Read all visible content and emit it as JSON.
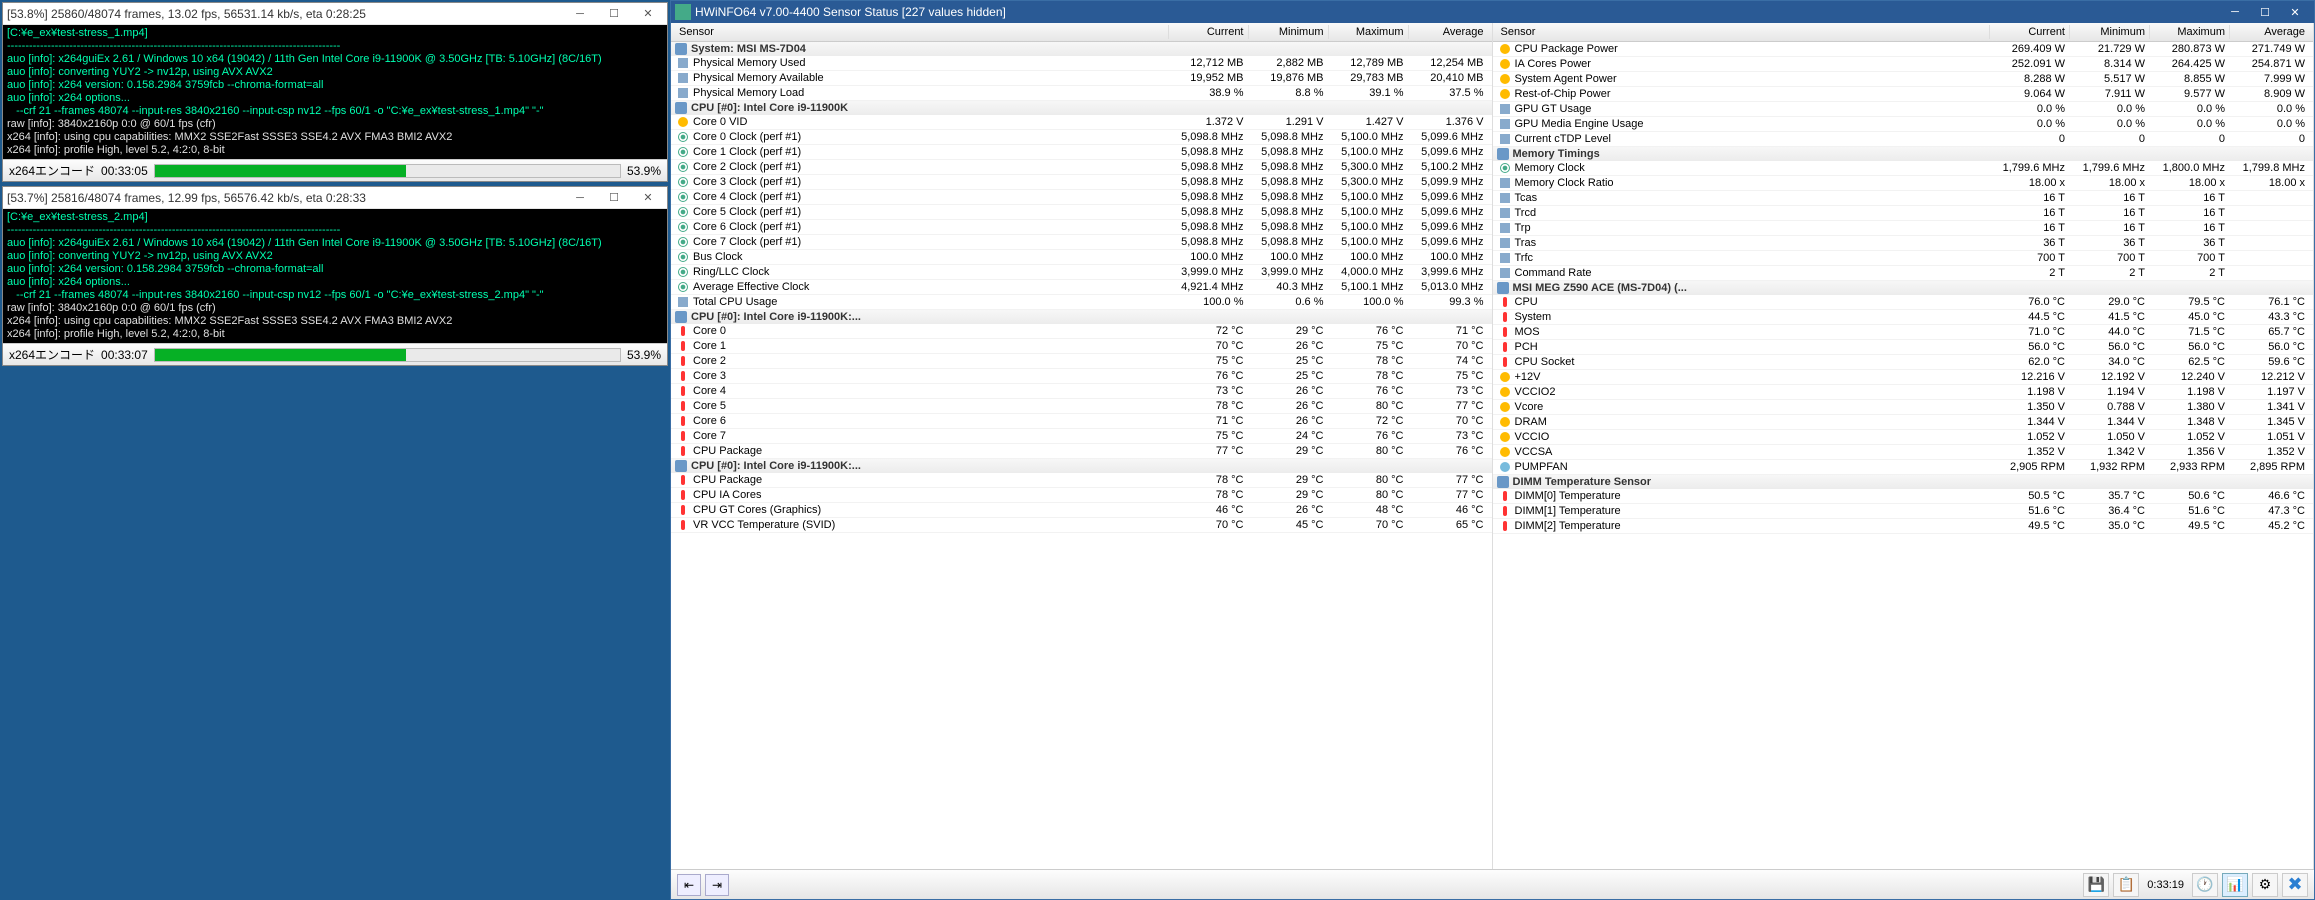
{
  "console1": {
    "title": "[53.8%] 25860/48074 frames, 13.02 fps, 56531.14 kb/s, eta 0:28:25",
    "lines": [
      {
        "cls": "cyan",
        "t": "[C:¥e_ex¥test-stress_1.mp4]"
      },
      {
        "cls": "cyan",
        "t": "-------------------------------------------------------------------------------------------"
      },
      {
        "cls": "cyan",
        "t": "auo [info]: x264guiEx 2.61 / Windows 10 x64 (19042) / 11th Gen Intel Core i9-11900K @ 3.50GHz [TB: 5.10GHz] (8C/16T)"
      },
      {
        "cls": "cyan",
        "t": "auo [info]: converting YUY2 -> nv12p, using AVX AVX2"
      },
      {
        "cls": "cyan",
        "t": "auo [info]: x264 version: 0.158.2984 3759fcb --chroma-format=all"
      },
      {
        "cls": "cyan",
        "t": "auo [info]: x264 options..."
      },
      {
        "cls": "cyan",
        "t": "   --crf 21 --frames 48074 --input-res 3840x2160 --input-csp nv12 --fps 60/1 -o \"C:¥e_ex¥test-stress_1.mp4\" \"-\""
      },
      {
        "cls": "white",
        "t": "raw [info]: 3840x2160p 0:0 @ 60/1 fps (cfr)"
      },
      {
        "cls": "white",
        "t": "x264 [info]: using cpu capabilities: MMX2 SSE2Fast SSSE3 SSE4.2 AVX FMA3 BMI2 AVX2"
      },
      {
        "cls": "white",
        "t": "x264 [info]: profile High, level 5.2, 4:2:0, 8-bit"
      }
    ],
    "status_label": "x264エンコード",
    "status_time": "00:33:05",
    "progress_pct": 53.9,
    "progress_text": "53.9%"
  },
  "console2": {
    "title": "[53.7%] 25816/48074 frames, 12.99 fps, 56576.42 kb/s, eta 0:28:33",
    "lines": [
      {
        "cls": "cyan",
        "t": "[C:¥e_ex¥test-stress_2.mp4]"
      },
      {
        "cls": "cyan",
        "t": "-------------------------------------------------------------------------------------------"
      },
      {
        "cls": "cyan",
        "t": "auo [info]: x264guiEx 2.61 / Windows 10 x64 (19042) / 11th Gen Intel Core i9-11900K @ 3.50GHz [TB: 5.10GHz] (8C/16T)"
      },
      {
        "cls": "cyan",
        "t": "auo [info]: converting YUY2 -> nv12p, using AVX AVX2"
      },
      {
        "cls": "cyan",
        "t": "auo [info]: x264 version: 0.158.2984 3759fcb --chroma-format=all"
      },
      {
        "cls": "cyan",
        "t": "auo [info]: x264 options..."
      },
      {
        "cls": "cyan",
        "t": "   --crf 21 --frames 48074 --input-res 3840x2160 --input-csp nv12 --fps 60/1 -o \"C:¥e_ex¥test-stress_2.mp4\" \"-\""
      },
      {
        "cls": "white",
        "t": "raw [info]: 3840x2160p 0:0 @ 60/1 fps (cfr)"
      },
      {
        "cls": "white",
        "t": "x264 [info]: using cpu capabilities: MMX2 SSE2Fast SSSE3 SSE4.2 AVX FMA3 BMI2 AVX2"
      },
      {
        "cls": "white",
        "t": "x264 [info]: profile High, level 5.2, 4:2:0, 8-bit"
      }
    ],
    "status_label": "x264エンコード",
    "status_time": "00:33:07",
    "progress_pct": 53.9,
    "progress_text": "53.9%"
  },
  "hw": {
    "title": "HWiNFO64 v7.00-4400 Sensor Status [227 values hidden]",
    "headers": [
      "Sensor",
      "Current",
      "Minimum",
      "Maximum",
      "Average"
    ],
    "left_groups": [
      {
        "name": "System: MSI MS-7D04",
        "rows": [
          {
            "ic": "mem",
            "n": "Physical Memory Used",
            "v": [
              "12,712 MB",
              "2,882 MB",
              "12,789 MB",
              "12,254 MB"
            ]
          },
          {
            "ic": "mem",
            "n": "Physical Memory Available",
            "v": [
              "19,952 MB",
              "19,876 MB",
              "29,783 MB",
              "20,410 MB"
            ]
          },
          {
            "ic": "mem",
            "n": "Physical Memory Load",
            "v": [
              "38.9 %",
              "8.8 %",
              "39.1 %",
              "37.5 %"
            ]
          }
        ]
      },
      {
        "name": "CPU [#0]: Intel Core i9-11900K",
        "rows": [
          {
            "ic": "volt",
            "n": "Core 0 VID",
            "v": [
              "1.372 V",
              "1.291 V",
              "1.427 V",
              "1.376 V"
            ]
          },
          {
            "ic": "clock",
            "n": "Core 0 Clock (perf #1)",
            "v": [
              "5,098.8 MHz",
              "5,098.8 MHz",
              "5,100.0 MHz",
              "5,099.6 MHz"
            ]
          },
          {
            "ic": "clock",
            "n": "Core 1 Clock (perf #1)",
            "v": [
              "5,098.8 MHz",
              "5,098.8 MHz",
              "5,100.0 MHz",
              "5,099.6 MHz"
            ]
          },
          {
            "ic": "clock",
            "n": "Core 2 Clock (perf #1)",
            "v": [
              "5,098.8 MHz",
              "5,098.8 MHz",
              "5,300.0 MHz",
              "5,100.2 MHz"
            ]
          },
          {
            "ic": "clock",
            "n": "Core 3 Clock (perf #1)",
            "v": [
              "5,098.8 MHz",
              "5,098.8 MHz",
              "5,300.0 MHz",
              "5,099.9 MHz"
            ]
          },
          {
            "ic": "clock",
            "n": "Core 4 Clock (perf #1)",
            "v": [
              "5,098.8 MHz",
              "5,098.8 MHz",
              "5,100.0 MHz",
              "5,099.6 MHz"
            ]
          },
          {
            "ic": "clock",
            "n": "Core 5 Clock (perf #1)",
            "v": [
              "5,098.8 MHz",
              "5,098.8 MHz",
              "5,100.0 MHz",
              "5,099.6 MHz"
            ]
          },
          {
            "ic": "clock",
            "n": "Core 6 Clock (perf #1)",
            "v": [
              "5,098.8 MHz",
              "5,098.8 MHz",
              "5,100.0 MHz",
              "5,099.6 MHz"
            ]
          },
          {
            "ic": "clock",
            "n": "Core 7 Clock (perf #1)",
            "v": [
              "5,098.8 MHz",
              "5,098.8 MHz",
              "5,100.0 MHz",
              "5,099.6 MHz"
            ]
          },
          {
            "ic": "clock",
            "n": "Bus Clock",
            "v": [
              "100.0 MHz",
              "100.0 MHz",
              "100.0 MHz",
              "100.0 MHz"
            ]
          },
          {
            "ic": "clock",
            "n": "Ring/LLC Clock",
            "v": [
              "3,999.0 MHz",
              "3,999.0 MHz",
              "4,000.0 MHz",
              "3,999.6 MHz"
            ]
          },
          {
            "ic": "clock",
            "n": "Average Effective Clock",
            "v": [
              "4,921.4 MHz",
              "40.3 MHz",
              "5,100.1 MHz",
              "5,013.0 MHz"
            ]
          },
          {
            "ic": "mem",
            "n": "Total CPU Usage",
            "v": [
              "100.0 %",
              "0.6 %",
              "100.0 %",
              "99.3 %"
            ]
          }
        ]
      },
      {
        "name": "CPU [#0]: Intel Core i9-11900K:...",
        "rows": [
          {
            "ic": "temp",
            "n": "Core 0",
            "v": [
              "72 °C",
              "29 °C",
              "76 °C",
              "71 °C"
            ]
          },
          {
            "ic": "temp",
            "n": "Core 1",
            "v": [
              "70 °C",
              "26 °C",
              "75 °C",
              "70 °C"
            ]
          },
          {
            "ic": "temp",
            "n": "Core 2",
            "v": [
              "75 °C",
              "25 °C",
              "78 °C",
              "74 °C"
            ]
          },
          {
            "ic": "temp",
            "n": "Core 3",
            "v": [
              "76 °C",
              "25 °C",
              "78 °C",
              "75 °C"
            ]
          },
          {
            "ic": "temp",
            "n": "Core 4",
            "v": [
              "73 °C",
              "26 °C",
              "76 °C",
              "73 °C"
            ]
          },
          {
            "ic": "temp",
            "n": "Core 5",
            "v": [
              "78 °C",
              "26 °C",
              "80 °C",
              "77 °C"
            ]
          },
          {
            "ic": "temp",
            "n": "Core 6",
            "v": [
              "71 °C",
              "26 °C",
              "72 °C",
              "70 °C"
            ]
          },
          {
            "ic": "temp",
            "n": "Core 7",
            "v": [
              "75 °C",
              "24 °C",
              "76 °C",
              "73 °C"
            ]
          },
          {
            "ic": "temp",
            "n": "CPU Package",
            "v": [
              "77 °C",
              "29 °C",
              "80 °C",
              "76 °C"
            ]
          }
        ]
      },
      {
        "name": "CPU [#0]: Intel Core i9-11900K:...",
        "rows": [
          {
            "ic": "temp",
            "n": "CPU Package",
            "v": [
              "78 °C",
              "29 °C",
              "80 °C",
              "77 °C"
            ]
          },
          {
            "ic": "temp",
            "n": "CPU IA Cores",
            "v": [
              "78 °C",
              "29 °C",
              "80 °C",
              "77 °C"
            ]
          },
          {
            "ic": "temp",
            "n": "CPU GT Cores (Graphics)",
            "v": [
              "46 °C",
              "26 °C",
              "48 °C",
              "46 °C"
            ]
          },
          {
            "ic": "temp",
            "n": "VR VCC Temperature (SVID)",
            "v": [
              "70 °C",
              "45 °C",
              "70 °C",
              "65 °C"
            ]
          }
        ]
      }
    ],
    "right_groups": [
      {
        "name": "",
        "rows": [
          {
            "ic": "volt",
            "n": "CPU Package Power",
            "v": [
              "269.409 W",
              "21.729 W",
              "280.873 W",
              "271.749 W"
            ]
          },
          {
            "ic": "volt",
            "n": "IA Cores Power",
            "v": [
              "252.091 W",
              "8.314 W",
              "264.425 W",
              "254.871 W"
            ]
          },
          {
            "ic": "volt",
            "n": "System Agent Power",
            "v": [
              "8.288 W",
              "5.517 W",
              "8.855 W",
              "7.999 W"
            ]
          },
          {
            "ic": "volt",
            "n": "Rest-of-Chip Power",
            "v": [
              "9.064 W",
              "7.911 W",
              "9.577 W",
              "8.909 W"
            ]
          },
          {
            "ic": "mem",
            "n": "GPU GT Usage",
            "v": [
              "0.0 %",
              "0.0 %",
              "0.0 %",
              "0.0 %"
            ]
          },
          {
            "ic": "mem",
            "n": "GPU Media Engine Usage",
            "v": [
              "0.0 %",
              "0.0 %",
              "0.0 %",
              "0.0 %"
            ]
          },
          {
            "ic": "mem",
            "n": "Current cTDP Level",
            "v": [
              "0",
              "0",
              "0",
              "0"
            ]
          }
        ]
      },
      {
        "name": "Memory Timings",
        "rows": [
          {
            "ic": "clock",
            "n": "Memory Clock",
            "v": [
              "1,799.6 MHz",
              "1,799.6 MHz",
              "1,800.0 MHz",
              "1,799.8 MHz"
            ]
          },
          {
            "ic": "mem",
            "n": "Memory Clock Ratio",
            "v": [
              "18.00 x",
              "18.00 x",
              "18.00 x",
              "18.00 x"
            ]
          },
          {
            "ic": "mem",
            "n": "Tcas",
            "v": [
              "16 T",
              "16 T",
              "16 T",
              ""
            ]
          },
          {
            "ic": "mem",
            "n": "Trcd",
            "v": [
              "16 T",
              "16 T",
              "16 T",
              ""
            ]
          },
          {
            "ic": "mem",
            "n": "Trp",
            "v": [
              "16 T",
              "16 T",
              "16 T",
              ""
            ]
          },
          {
            "ic": "mem",
            "n": "Tras",
            "v": [
              "36 T",
              "36 T",
              "36 T",
              ""
            ]
          },
          {
            "ic": "mem",
            "n": "Trfc",
            "v": [
              "700 T",
              "700 T",
              "700 T",
              ""
            ]
          },
          {
            "ic": "mem",
            "n": "Command Rate",
            "v": [
              "2 T",
              "2 T",
              "2 T",
              ""
            ]
          }
        ]
      },
      {
        "name": "MSI MEG Z590 ACE (MS-7D04) (...",
        "rows": [
          {
            "ic": "temp",
            "n": "CPU",
            "v": [
              "76.0 °C",
              "29.0 °C",
              "79.5 °C",
              "76.1 °C"
            ]
          },
          {
            "ic": "temp",
            "n": "System",
            "v": [
              "44.5 °C",
              "41.5 °C",
              "45.0 °C",
              "43.3 °C"
            ]
          },
          {
            "ic": "temp",
            "n": "MOS",
            "v": [
              "71.0 °C",
              "44.0 °C",
              "71.5 °C",
              "65.7 °C"
            ]
          },
          {
            "ic": "temp",
            "n": "PCH",
            "v": [
              "56.0 °C",
              "56.0 °C",
              "56.0 °C",
              "56.0 °C"
            ]
          },
          {
            "ic": "temp",
            "n": "CPU Socket",
            "v": [
              "62.0 °C",
              "34.0 °C",
              "62.5 °C",
              "59.6 °C"
            ]
          },
          {
            "ic": "volt",
            "n": "+12V",
            "v": [
              "12.216 V",
              "12.192 V",
              "12.240 V",
              "12.212 V"
            ]
          },
          {
            "ic": "volt",
            "n": "VCCIO2",
            "v": [
              "1.198 V",
              "1.194 V",
              "1.198 V",
              "1.197 V"
            ]
          },
          {
            "ic": "volt",
            "n": "Vcore",
            "v": [
              "1.350 V",
              "0.788 V",
              "1.380 V",
              "1.341 V"
            ]
          },
          {
            "ic": "volt",
            "n": "DRAM",
            "v": [
              "1.344 V",
              "1.344 V",
              "1.348 V",
              "1.345 V"
            ]
          },
          {
            "ic": "volt",
            "n": "VCCIO",
            "v": [
              "1.052 V",
              "1.050 V",
              "1.052 V",
              "1.051 V"
            ]
          },
          {
            "ic": "volt",
            "n": "VCCSA",
            "v": [
              "1.352 V",
              "1.342 V",
              "1.356 V",
              "1.352 V"
            ]
          },
          {
            "ic": "fan",
            "n": "PUMPFAN",
            "v": [
              "2,905 RPM",
              "1,932 RPM",
              "2,933 RPM",
              "2,895 RPM"
            ]
          }
        ]
      },
      {
        "name": "DIMM Temperature Sensor",
        "rows": [
          {
            "ic": "temp",
            "n": "DIMM[0] Temperature",
            "v": [
              "50.5 °C",
              "35.7 °C",
              "50.6 °C",
              "46.6 °C"
            ]
          },
          {
            "ic": "temp",
            "n": "DIMM[1] Temperature",
            "v": [
              "51.6 °C",
              "36.4 °C",
              "51.6 °C",
              "47.3 °C"
            ]
          },
          {
            "ic": "temp",
            "n": "DIMM[2] Temperature",
            "v": [
              "49.5 °C",
              "35.0 °C",
              "49.5 °C",
              "45.2 °C"
            ]
          }
        ]
      }
    ],
    "footer_time": "0:33:19"
  }
}
